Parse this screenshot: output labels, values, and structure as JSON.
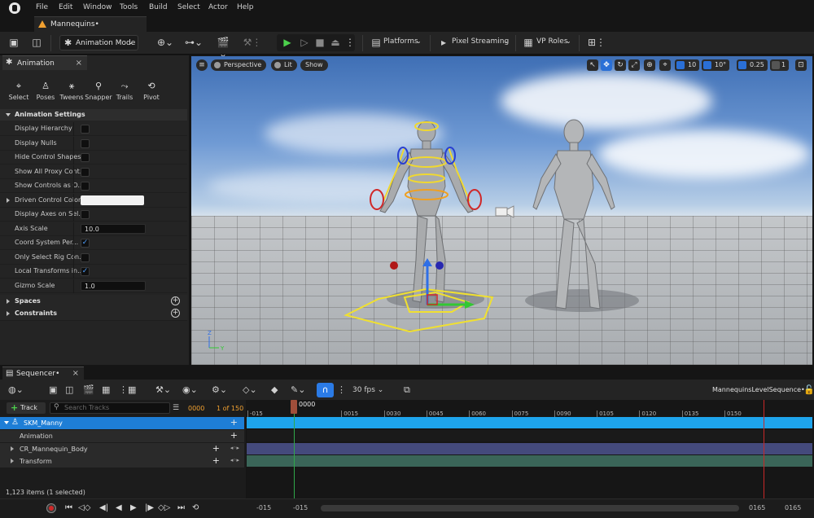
{
  "menu": [
    "File",
    "Edit",
    "Window",
    "Tools",
    "Build",
    "Select",
    "Actor",
    "Help"
  ],
  "document_tab": "Mannequins•",
  "toolbar": {
    "mode": "Animation Mode",
    "platforms": "Platforms",
    "pixel_streaming": "Pixel Streaming",
    "vp_roles": "VP Roles"
  },
  "anim_panel": {
    "tab": "Animation",
    "tools": [
      "Select",
      "Poses",
      "Tweens",
      "Snapper",
      "Trails",
      "Pivot"
    ],
    "section": "Animation Settings",
    "props": [
      {
        "label": "Display Hierarchy",
        "type": "check",
        "checked": false
      },
      {
        "label": "Display Nulls",
        "type": "check",
        "checked": false
      },
      {
        "label": "Hide Control Shapes",
        "type": "check",
        "checked": false
      },
      {
        "label": "Show All Proxy Cont...",
        "type": "check",
        "checked": false
      },
      {
        "label": "Show Controls as O...",
        "type": "check",
        "checked": false
      },
      {
        "label": "Driven Control Color",
        "type": "color",
        "expand": true
      },
      {
        "label": "Display Axes on Sel...",
        "type": "check",
        "checked": false
      },
      {
        "label": "Axis Scale",
        "type": "number",
        "value": "10.0"
      },
      {
        "label": "Coord System Per...",
        "type": "check",
        "checked": true
      },
      {
        "label": "Only Select Rig Con...",
        "type": "check",
        "checked": false
      },
      {
        "label": "Local Transforms in...",
        "type": "check",
        "checked": true
      },
      {
        "label": "Gizmo Scale",
        "type": "number",
        "value": "1.0"
      }
    ],
    "groups": [
      "Spaces",
      "Constraints"
    ]
  },
  "viewport": {
    "perspective": "Perspective",
    "lit": "Lit",
    "show": "Show",
    "grid_snap": "10",
    "rot_snap": "10°",
    "scale_snap": "0.25",
    "cam_speed": "1"
  },
  "sequencer": {
    "tab": "Sequencer•",
    "fps": "30 fps",
    "sequence_name": "MannequinsLevelSequence•",
    "add_track": "Track",
    "search_placeholder": "Search Tracks",
    "current_frame": "0000",
    "frame_count": "1 of 150",
    "playhead": "0000",
    "tracks": [
      {
        "name": "SKM_Manny",
        "level": 0,
        "selected": true
      },
      {
        "name": "Animation",
        "level": 1
      },
      {
        "name": "CR_Mannequin_Body",
        "level": 1,
        "expand": true
      },
      {
        "name": "Transform",
        "level": 1,
        "expand": true
      }
    ],
    "ticks": [
      "-015",
      "0015",
      "0030",
      "0045",
      "0060",
      "0075",
      "0090",
      "0105",
      "0120",
      "0135",
      "0150"
    ],
    "status": "1,123 items (1 selected)",
    "range_start_a": "-015",
    "range_start_b": "-015",
    "range_end_a": "0165",
    "range_end_b": "0165"
  }
}
